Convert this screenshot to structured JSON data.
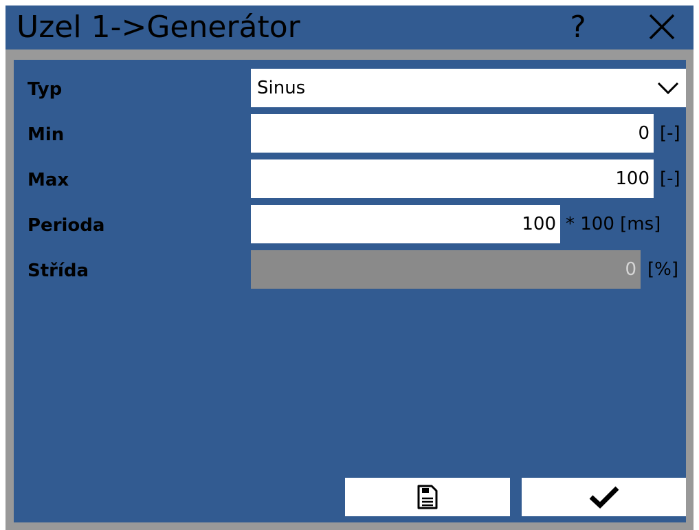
{
  "window": {
    "title": "Uzel 1->Generátor",
    "help_label": "?"
  },
  "form": {
    "typ": {
      "label": "Typ",
      "value": "Sinus"
    },
    "min": {
      "label": "Min",
      "value": "0",
      "unit": "[-]"
    },
    "max": {
      "label": "Max",
      "value": "100",
      "unit": "[-]"
    },
    "perioda": {
      "label": "Perioda",
      "value": "100",
      "unit": "* 100 [ms]"
    },
    "strida": {
      "label": "Střída",
      "value": "0",
      "unit": "[%]"
    }
  },
  "icons": {
    "help": "help-icon",
    "close": "close-icon",
    "dropdown": "chevron-down-icon",
    "save": "save-icon",
    "confirm": "checkmark-icon"
  },
  "colors": {
    "panel": "#325b91",
    "frame": "#999999",
    "field": "#ffffff",
    "field_disabled": "#8a8a8a"
  }
}
